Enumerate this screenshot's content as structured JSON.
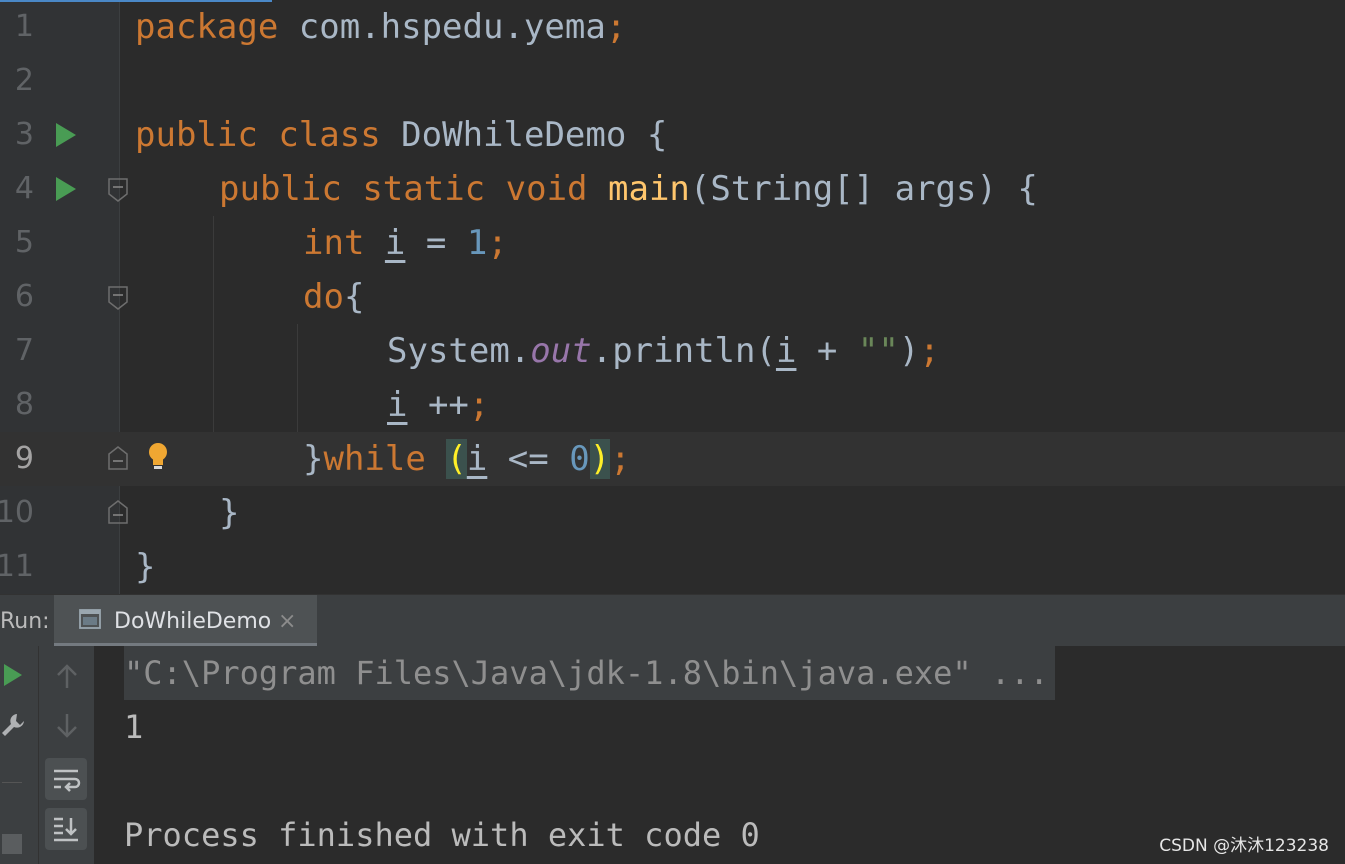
{
  "editor": {
    "lines": [
      {
        "num": "1"
      },
      {
        "num": "2"
      },
      {
        "num": "3"
      },
      {
        "num": "4"
      },
      {
        "num": "5"
      },
      {
        "num": "6"
      },
      {
        "num": "7"
      },
      {
        "num": "8"
      },
      {
        "num": "9"
      },
      {
        "num": "10"
      },
      {
        "num": "11"
      }
    ],
    "tokens": {
      "package_kw": "package",
      "package_name": " com.hspedu.yema",
      "semicolon": ";",
      "public": "public",
      "class": "class",
      "class_name": "DoWhileDemo",
      "open_brace": "{",
      "close_brace": "}",
      "static": "static",
      "void": "void",
      "main": "main",
      "params": "(String[] args) ",
      "int": "int",
      "var_i": "i",
      "assign": " = ",
      "one": "1",
      "do": "do",
      "system": "System.",
      "out": "out",
      "println": ".println(",
      "plus": " + ",
      "empty_string": "\"\"",
      "close_paren": ")",
      "increment": " ++",
      "while": "while",
      "space": " ",
      "open_paren": "(",
      "le": " <= ",
      "zero": "0"
    }
  },
  "run_panel": {
    "label": "Run:",
    "tab_label": "DoWhileDemo",
    "tab_close": "×",
    "console_lines": [
      "\"C:\\Program Files\\Java\\jdk-1.8\\bin\\java.exe\" ...",
      "1",
      "",
      "Process finished with exit code 0"
    ]
  },
  "watermark": "CSDN @沐沐123238",
  "colors": {
    "keyword": "#cc7832",
    "function": "#ffc66d",
    "number": "#6897bb",
    "string": "#6a8759",
    "field": "#9876aa",
    "text": "#a9b7c6",
    "run_green": "#499c54"
  }
}
